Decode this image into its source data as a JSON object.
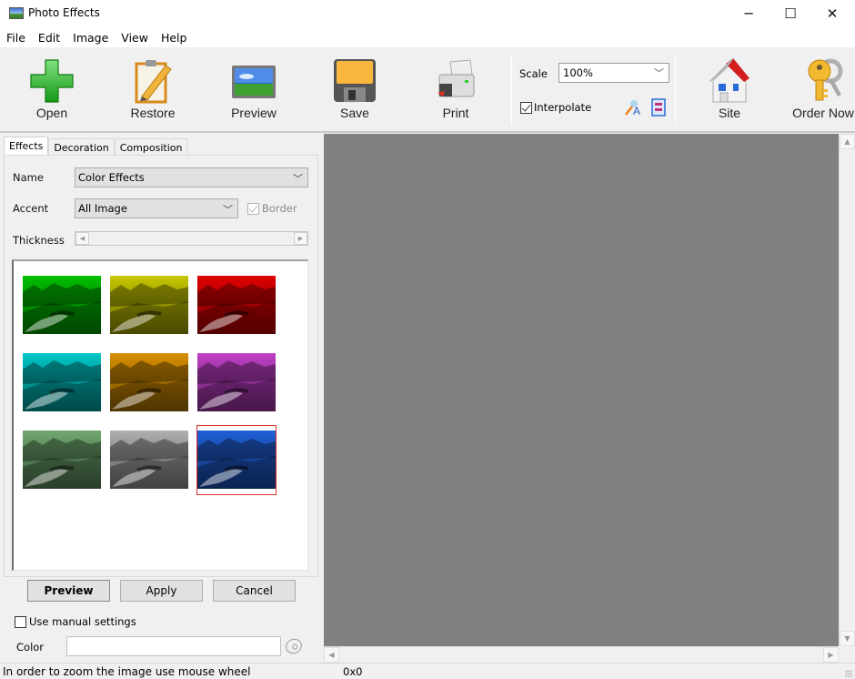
{
  "window": {
    "title": "Photo Effects",
    "controls": {
      "minimize": "─",
      "maximize": "☐",
      "close": "✕"
    }
  },
  "menu": [
    "File",
    "Edit",
    "Image",
    "View",
    "Help"
  ],
  "toolbar": {
    "buttons": [
      {
        "id": "open",
        "label": "Open",
        "icon": "green-plus-icon"
      },
      {
        "id": "restore",
        "label": "Restore",
        "icon": "notepad-pencil-icon"
      },
      {
        "id": "preview",
        "label": "Preview",
        "icon": "landscape-picture-icon"
      },
      {
        "id": "save",
        "label": "Save",
        "icon": "floppy-disk-icon"
      },
      {
        "id": "print",
        "label": "Print",
        "icon": "printer-icon"
      },
      {
        "id": "site",
        "label": "Site",
        "icon": "house-icon"
      },
      {
        "id": "order",
        "label": "Order Now",
        "icon": "keys-icon"
      }
    ],
    "scale_label": "Scale",
    "scale_value": "100%",
    "interpolate_label": "Interpolate",
    "interpolate_checked": true,
    "extra_icons": [
      "magic-text-icon",
      "page-layout-icon"
    ]
  },
  "left_panel": {
    "tabs": [
      {
        "label": "Effects",
        "active": true
      },
      {
        "label": "Decoration",
        "active": false
      },
      {
        "label": "Composition",
        "active": false
      }
    ],
    "name_label": "Name",
    "name_value": "Color Effects",
    "accent_label": "Accent",
    "accent_value": "All Image",
    "border_label": "Border",
    "border_checked": true,
    "border_enabled": false,
    "thickness_label": "Thickness",
    "thumbnails": [
      {
        "name": "green",
        "tint": "#00c000",
        "selected": false
      },
      {
        "name": "yellow",
        "tint": "#c8c800",
        "selected": false
      },
      {
        "name": "red",
        "tint": "#e00000",
        "selected": false
      },
      {
        "name": "cyan",
        "tint": "#00c8c8",
        "selected": false
      },
      {
        "name": "orange",
        "tint": "#d89000",
        "selected": false
      },
      {
        "name": "magenta",
        "tint": "#c040c8",
        "selected": false
      },
      {
        "name": "pale-green",
        "tint": "#70a870",
        "selected": false
      },
      {
        "name": "gray",
        "tint": "#b0b0b0",
        "selected": false
      },
      {
        "name": "blue",
        "tint": "#2060d8",
        "selected": true
      }
    ],
    "preview_label": "Preview",
    "apply_label": "Apply",
    "cancel_label": "Cancel",
    "manual_label": "Use manual settings",
    "manual_checked": false,
    "color_label": "Color",
    "color_value": ""
  },
  "status": {
    "hint": "In order to zoom the image use mouse wheel",
    "dimensions": "0x0"
  }
}
